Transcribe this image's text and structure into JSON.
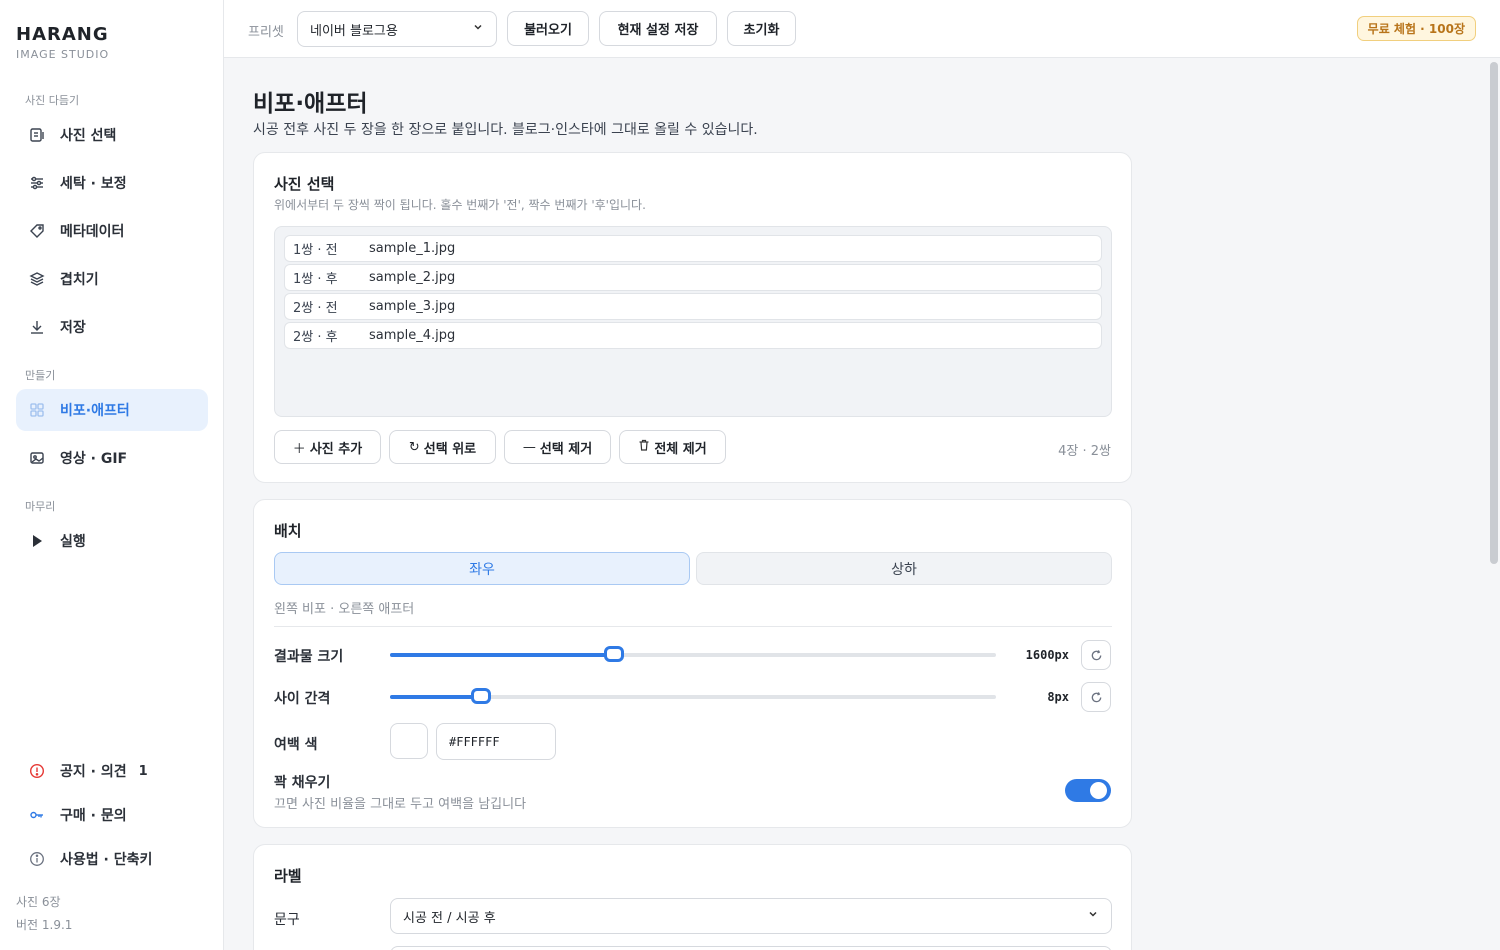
{
  "brand": {
    "title": "HARANG",
    "subtitle": "IMAGE STUDIO"
  },
  "sidebar": {
    "sections": [
      {
        "label": "사진 다듬기",
        "items": [
          {
            "label": "사진 선택",
            "icon": "photo-select-icon"
          },
          {
            "label": "세탁 · 보정",
            "icon": "sliders-icon"
          },
          {
            "label": "메타데이터",
            "icon": "tag-icon"
          },
          {
            "label": "겹치기",
            "icon": "layers-icon"
          },
          {
            "label": "저장",
            "icon": "download-icon"
          }
        ]
      },
      {
        "label": "만들기",
        "items": [
          {
            "label": "비포·애프터",
            "icon": "grid-icon",
            "active": true
          },
          {
            "label": "영상 · GIF",
            "icon": "image-icon"
          }
        ]
      },
      {
        "label": "마무리",
        "items": [
          {
            "label": "실행",
            "icon": "play-icon"
          }
        ]
      }
    ],
    "bottom_items": [
      {
        "label": "공지 · 의견",
        "icon": "alert-icon",
        "badge": "1"
      },
      {
        "label": "구매 · 문의",
        "icon": "key-icon"
      },
      {
        "label": "사용법 · 단축키",
        "icon": "info-icon"
      }
    ],
    "footer": {
      "photos": "사진 6장",
      "version": "버전 1.9.1"
    }
  },
  "topbar": {
    "preset_label": "프리셋",
    "preset_value": "네이버 블로그용",
    "load_button": "불러오기",
    "save_button": "현재 설정 저장",
    "reset_button": "초기화",
    "trial_badge": "무료 체험 · 100장"
  },
  "page": {
    "title": "비포·애프터",
    "description": "시공 전후 사진 두 장을 한 장으로 붙입니다. 블로그·인스타에 그대로 올릴 수 있습니다."
  },
  "photo_card": {
    "title": "사진 선택",
    "subtitle": "위에서부터 두 장씩 짝이 됩니다. 홀수 번째가 '전', 짝수 번째가 '후'입니다.",
    "files": [
      {
        "tag": "1쌍 · 전",
        "name": "sample_1.jpg"
      },
      {
        "tag": "1쌍 · 후",
        "name": "sample_2.jpg"
      },
      {
        "tag": "2쌍 · 전",
        "name": "sample_3.jpg"
      },
      {
        "tag": "2쌍 · 후",
        "name": "sample_4.jpg"
      }
    ],
    "add_button": "사진 추가",
    "up_button": "선택 위로",
    "remove_button": "선택 제거",
    "clear_button": "전체 제거",
    "count": "4장 · 2쌍"
  },
  "layout_card": {
    "title": "배치",
    "seg_left": "좌우",
    "seg_right": "상하",
    "hint": "왼쪽 비포 · 오른쪽 애프터",
    "size_label": "결과물 크기",
    "size_value": "1600px",
    "size_level": 0.37,
    "gap_label": "사이 간격",
    "gap_value": "8px",
    "gap_level": 0.15,
    "margin_label": "여백 색",
    "margin_color": "#FFFFFF",
    "fill_label": "꽉 채우기",
    "fill_desc": "끄면 사진 비율을 그대로 두고 여백을 남깁니다",
    "fill_on": true
  },
  "label_card": {
    "title": "라벨",
    "text_label": "문구",
    "text_value": "시공 전 / 시공 후"
  },
  "colors": {
    "accent": "#2f7ae5",
    "trial_bg": "#fff6df",
    "trial_text": "#b8741a"
  }
}
